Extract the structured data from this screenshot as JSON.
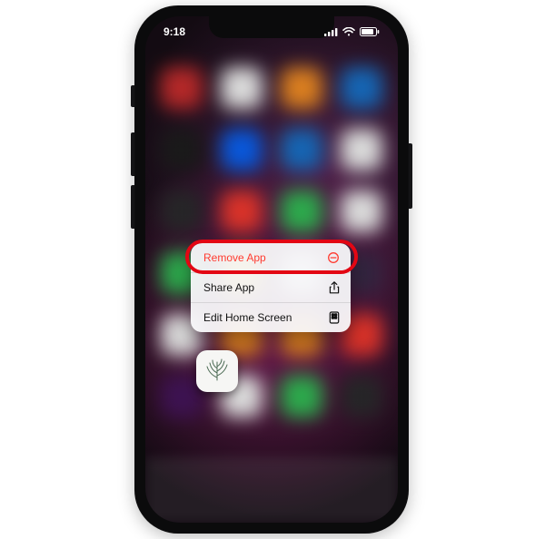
{
  "status": {
    "time": "9:18"
  },
  "context_menu": {
    "remove_label": "Remove App",
    "share_label": "Share App",
    "edit_label": "Edit Home Screen"
  },
  "icons": {
    "remove": "minus-circle-icon",
    "share": "share-icon",
    "edit": "edit-home-icon",
    "signal": "cellular-signal-icon",
    "wifi": "wifi-icon",
    "battery": "battery-icon",
    "app": "leaf-app-icon"
  },
  "highlight": {
    "target": "remove_app"
  }
}
